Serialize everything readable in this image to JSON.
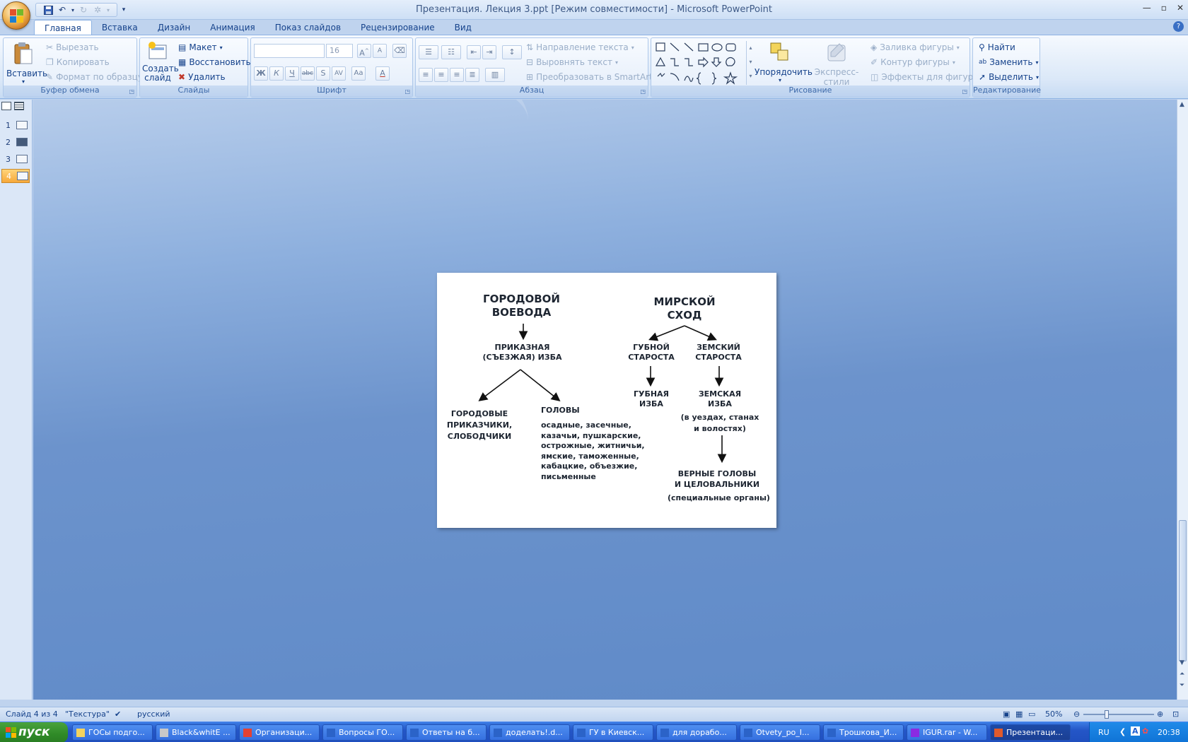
{
  "window": {
    "title": "Презентация. Лекция 3.ppt [Режим совместимости] - Microsoft PowerPoint"
  },
  "ribbon": {
    "tabs": [
      "Главная",
      "Вставка",
      "Дизайн",
      "Анимация",
      "Показ слайдов",
      "Рецензирование",
      "Вид"
    ],
    "active_tab": "Главная",
    "clipboard": {
      "label": "Буфер обмена",
      "paste": "Вставить",
      "cut": "Вырезать",
      "copy": "Копировать",
      "format_painter": "Формат по образцу"
    },
    "slides": {
      "label": "Слайды",
      "new_slide_1": "Создать",
      "new_slide_2": "слайд",
      "layout": "Макет",
      "reset": "Восстановить",
      "delete": "Удалить"
    },
    "font": {
      "label": "Шрифт",
      "font_size": "16"
    },
    "paragraph": {
      "label": "Абзац",
      "text_direction": "Направление текста",
      "align_text": "Выровнять текст",
      "smartart": "Преобразовать в SmartArt"
    },
    "drawing": {
      "label": "Рисование",
      "arrange": "Упорядочить",
      "quick_styles": "Экспресс-стили",
      "shape_fill": "Заливка фигуры",
      "shape_outline": "Контур фигуры",
      "shape_effects": "Эффекты для фигур"
    },
    "editing": {
      "label": "Редактирование",
      "find": "Найти",
      "replace": "Заменить",
      "select": "Выделить"
    }
  },
  "slides_pane": {
    "slides": [
      "1",
      "2",
      "3",
      "4"
    ],
    "active": "4"
  },
  "slide": {
    "left_title_1": "ГОРОДОВОЙ",
    "left_title_2": "ВОЕВОДА",
    "prikaz_1": "ПРИКАЗНАЯ",
    "prikaz_2": "(СЪЕЗЖАЯ) ИЗБА",
    "gorod_1": "ГОРОДОВЫЕ",
    "gorod_2": "ПРИКАЗЧИКИ,",
    "gorod_3": "СЛОБОДЧИКИ",
    "golovy": "ГОЛОВЫ",
    "golovy_list": [
      "осадные, засечные,",
      "казачьи, пушкарские,",
      "острожные, житничьи,",
      "ямские, таможенные,",
      "кабацкие, объезжие,",
      "письменные"
    ],
    "right_title_1": "МИРСКОЙ",
    "right_title_2": "СХОД",
    "guba_1": "ГУБНОЙ",
    "guba_2": "СТАРОСТА",
    "zem_1": "ЗЕМСКИЙ",
    "zem_2": "СТАРОСТА",
    "gizba_1": "ГУБНАЯ",
    "gizba_2": "ИЗБА",
    "zizba_1": "ЗЕМСКАЯ",
    "zizba_2": "ИЗБА",
    "zizba_3": "(в уездах, станах",
    "zizba_4": "и волостях)",
    "vernye_1": "ВЕРНЫЕ ГОЛОВЫ",
    "vernye_2": "И ЦЕЛОВАЛЬНИКИ",
    "vernye_3": "(специальные органы)"
  },
  "status": {
    "slide_info": "Слайд 4 из 4",
    "theme": "\"Текстура\"",
    "language": "русский",
    "zoom": "50%",
    "zoom_fraction": 0.3
  },
  "taskbar": {
    "start": "пуск",
    "tasks": [
      "ГОСы подго...",
      "Black&whitE ...",
      "Организаци...",
      "Вопросы ГО...",
      "Ответы на б...",
      "доделать!.d...",
      "ГУ в Киевск...",
      "для дорабо...",
      "Otvety_po_I...",
      "Трошкова_И...",
      "IGUR.rar - W...",
      "Презентаци..."
    ],
    "active_task": "Презентаци...",
    "lang": "RU",
    "clock": "20:38"
  },
  "colors": {
    "ribbon_text": "#15428b",
    "workspace": "#6c93cc",
    "taskbar": "#2456c7",
    "start": "#2f8a27"
  }
}
